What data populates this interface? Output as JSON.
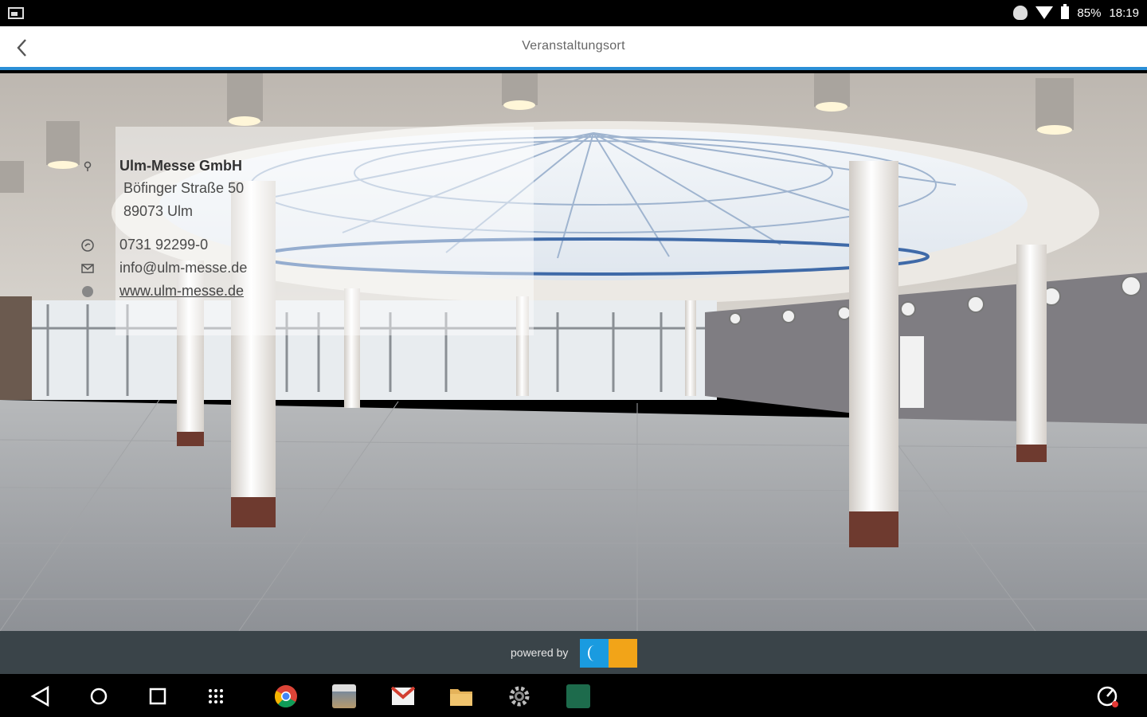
{
  "status_bar": {
    "battery": "85%",
    "time": "18:19"
  },
  "app_bar": {
    "title": "Veranstaltungsort"
  },
  "venue": {
    "name": "Ulm-Messe GmbH",
    "street": "Böfinger Straße 50",
    "city": "89073 Ulm",
    "phone": "0731 92299-0",
    "email": "info@ulm-messe.de",
    "website": "www.ulm-messe.de"
  },
  "footer": {
    "powered_by": "powered by"
  },
  "nav_bar": {
    "items": [
      "back-icon",
      "home-icon",
      "recents-icon",
      "app-drawer-icon",
      "chrome-icon",
      "gallery-icon",
      "gmail-icon",
      "files-icon",
      "settings-icon",
      "messe-app-icon",
      "speed-icon"
    ]
  },
  "colors": {
    "accent": "#2b8fd6",
    "footer_bg": "#3a4449",
    "logo_blue": "#1a9be0",
    "logo_orange": "#f2a418"
  }
}
